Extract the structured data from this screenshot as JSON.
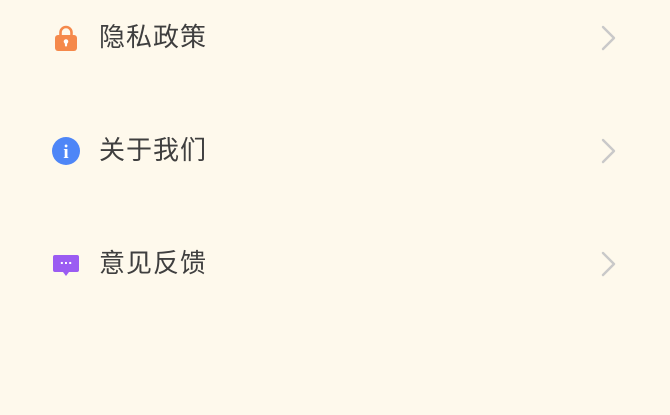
{
  "menu": {
    "items": [
      {
        "label": "隐私政策",
        "icon": "lock-icon",
        "icon_color": "#F5894B"
      },
      {
        "label": "关于我们",
        "icon": "info-icon",
        "icon_color": "#4E86F7",
        "icon_glyph": "i"
      },
      {
        "label": "意见反馈",
        "icon": "feedback-icon",
        "icon_color": "#9B5CF2",
        "icon_glyph": "···"
      }
    ],
    "chevron_icon": "chevron-right-icon",
    "chevron_color": "#C9C9C9",
    "text_color": "#3F3F3F",
    "background_color": "#FEF9EC"
  }
}
